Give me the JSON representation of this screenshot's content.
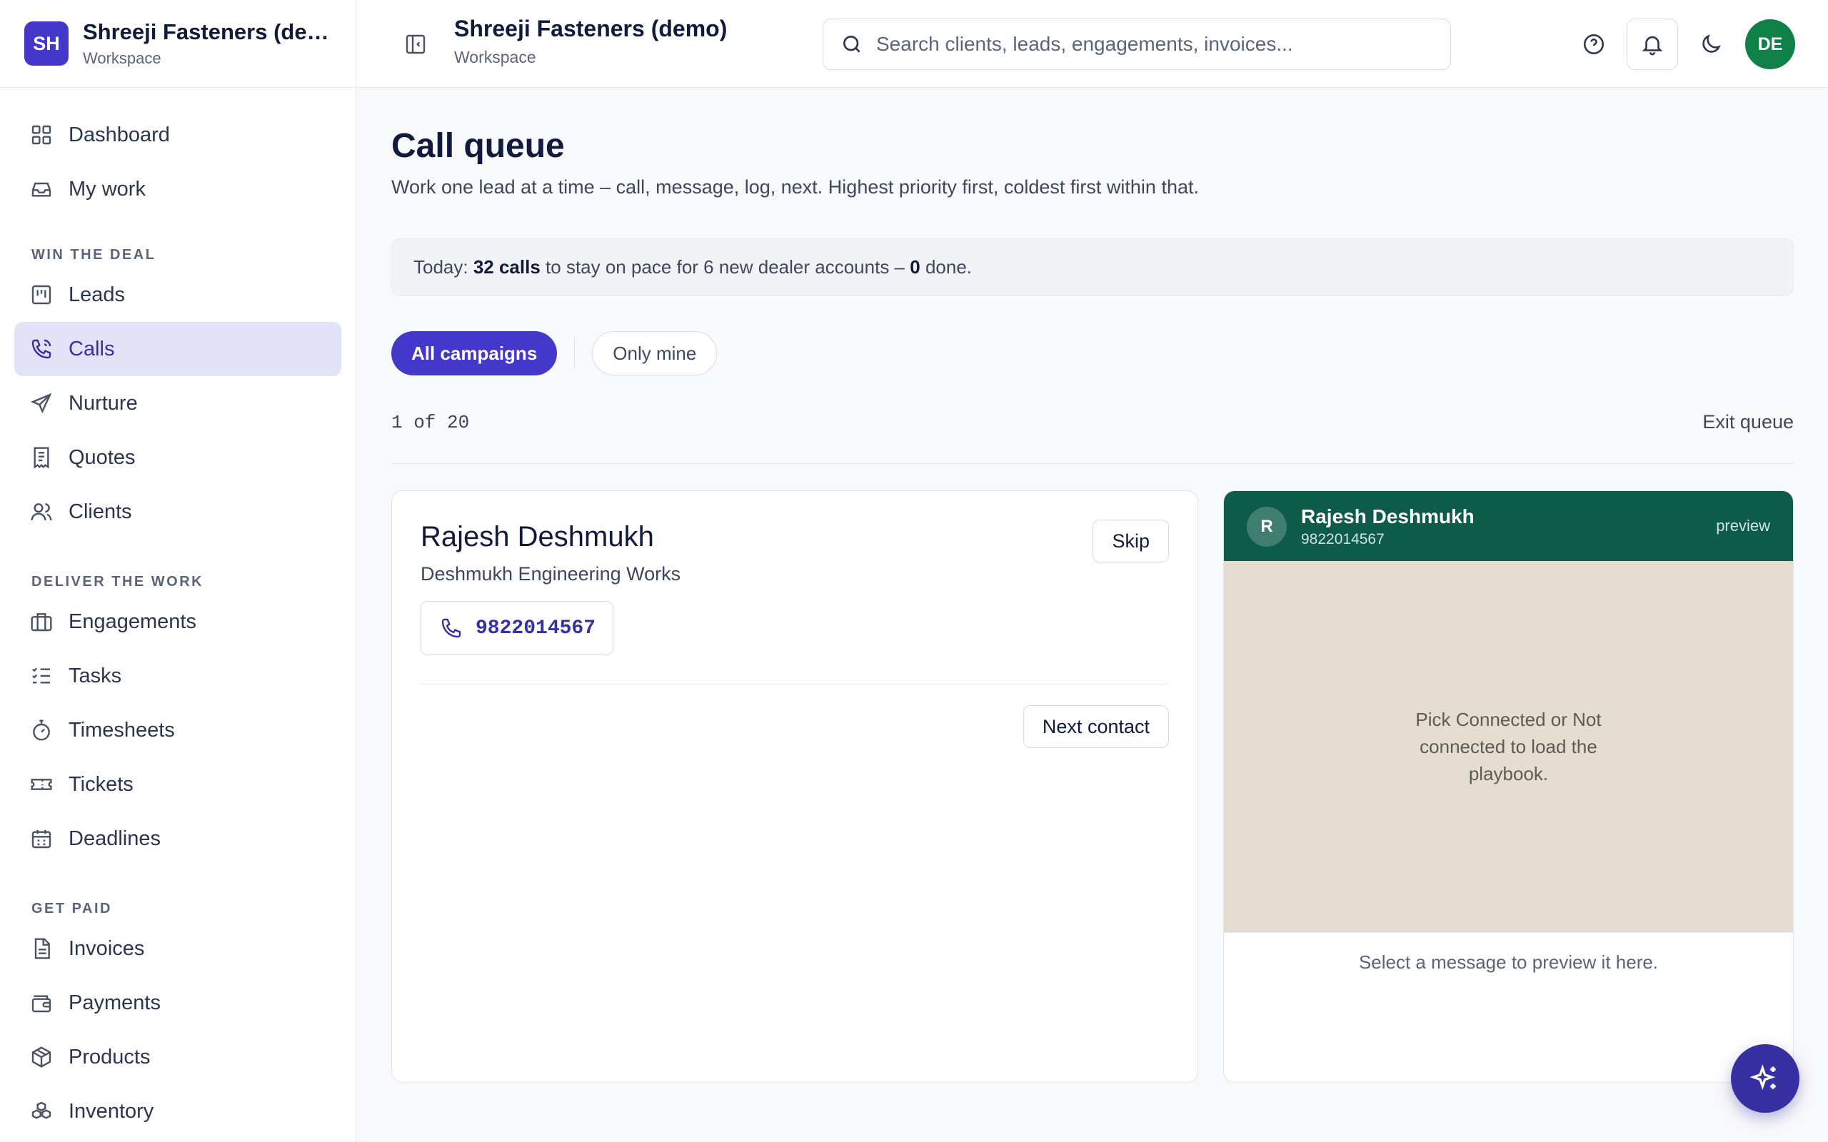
{
  "brand": {
    "initials": "SH",
    "title": "Shreeji Fasteners (demo)",
    "subtitle": "Workspace"
  },
  "header": {
    "title": "Shreeji Fasteners (demo)",
    "subtitle": "Workspace",
    "search_placeholder": "Search clients, leads, engagements, invoices...",
    "avatar_initials": "DE"
  },
  "sidebar": {
    "top_items": [
      {
        "label": "Dashboard",
        "icon": "grid-icon"
      },
      {
        "label": "My work",
        "icon": "inbox-icon"
      }
    ],
    "sections": [
      {
        "heading": "WIN THE DEAL",
        "items": [
          {
            "label": "Leads",
            "icon": "board-icon"
          },
          {
            "label": "Calls",
            "icon": "phone-icon",
            "active": true
          },
          {
            "label": "Nurture",
            "icon": "send-icon"
          },
          {
            "label": "Quotes",
            "icon": "receipt-icon"
          },
          {
            "label": "Clients",
            "icon": "users-icon"
          }
        ]
      },
      {
        "heading": "DELIVER THE WORK",
        "items": [
          {
            "label": "Engagements",
            "icon": "briefcase-icon"
          },
          {
            "label": "Tasks",
            "icon": "checklist-icon"
          },
          {
            "label": "Timesheets",
            "icon": "stopwatch-icon"
          },
          {
            "label": "Tickets",
            "icon": "ticket-icon"
          },
          {
            "label": "Deadlines",
            "icon": "calendar-icon"
          }
        ]
      },
      {
        "heading": "GET PAID",
        "items": [
          {
            "label": "Invoices",
            "icon": "file-text-icon"
          },
          {
            "label": "Payments",
            "icon": "wallet-icon"
          },
          {
            "label": "Products",
            "icon": "package-icon"
          },
          {
            "label": "Inventory",
            "icon": "boxes-icon"
          }
        ]
      }
    ]
  },
  "main": {
    "title": "Call queue",
    "subtitle": "Work one lead at a time – call, message, log, next. Highest priority first, coldest first within that.",
    "pace": {
      "prefix": "Today: ",
      "calls": "32 calls",
      "middle": " to stay on pace for 6 new dealer accounts – ",
      "done_count": "0",
      "suffix": " done."
    },
    "filters": {
      "all": "All campaigns",
      "mine": "Only mine"
    },
    "counter": "1 of 20",
    "exit_label": "Exit queue",
    "contact": {
      "name": "Rajesh Deshmukh",
      "company": "Deshmukh Engineering Works",
      "phone": "9822014567",
      "skip_label": "Skip",
      "next_label": "Next contact"
    },
    "whatsapp_preview": {
      "initial": "R",
      "name": "Rajesh Deshmukh",
      "phone": "9822014567",
      "badge": "preview",
      "body": "Pick Connected or Not connected to load the playbook.",
      "footer": "Select a message to preview it here."
    }
  },
  "colors": {
    "accent": "#4338ca",
    "active_nav_bg": "#e3e3f7",
    "avatar_bg": "#0f8048",
    "wa_header": "#0d5c4a",
    "wa_body": "#e6ddd1"
  }
}
